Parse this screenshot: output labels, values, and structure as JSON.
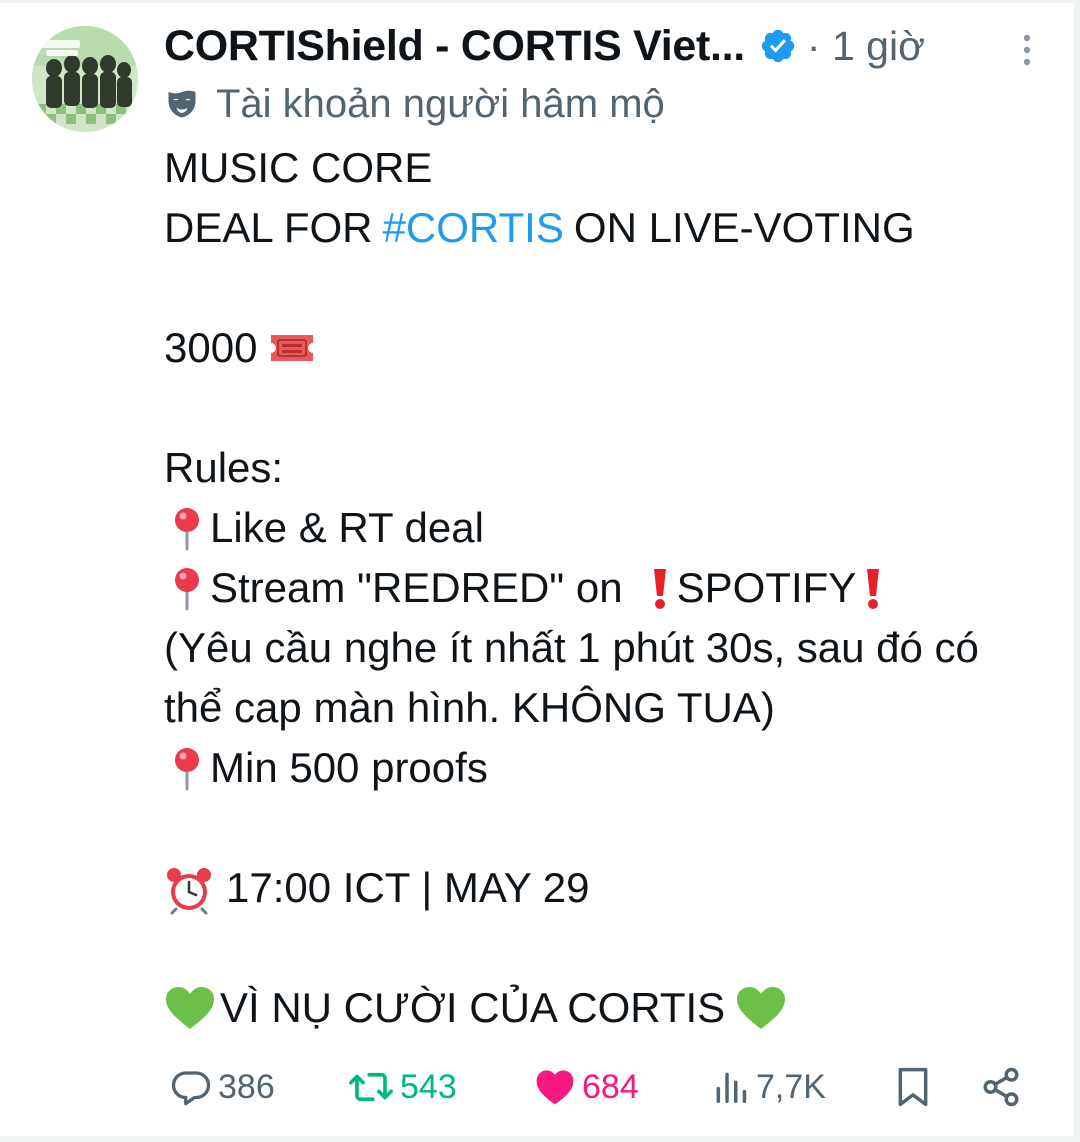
{
  "author": {
    "display_name": "CORTIShield - CORTIS Viet...",
    "verified_icon": "verified-badge-icon",
    "time": "· 1 giờ",
    "label_icon": "fan-account-mask-icon",
    "label": "Tài khoản người hâm mộ",
    "avatar": "group-photo-avatar"
  },
  "tweet": {
    "line1": "MUSIC CORE",
    "line2_pre": "DEAL FOR",
    "line2_hashtag": "#CORTIS",
    "line2_post": "ON LIVE-VOTING",
    "amount": "3000",
    "amount_icon": "ticket-icon",
    "rules_title": "Rules:",
    "rule1": "Like & RT deal",
    "rule2_pre": "Stream \"REDRED\" on",
    "rule2_platform": "SPOTIFY",
    "rule2_note_line1": "(Yêu cầu nghe ít nhất 1 phút 30s, sau đó có",
    "rule2_note_line2": "thể cap màn hình. KHÔNG TUA)",
    "rule3": "Min 500 proofs",
    "time_line": "17:00 ICT | MAY 29",
    "closing": "VÌ NỤ CƯỜI CỦA CORTIS"
  },
  "actions": {
    "replies": "386",
    "retweets": "543",
    "likes": "684",
    "views": "7,7K"
  },
  "colors": {
    "text": "#0f1419",
    "secondary": "#536471",
    "hashtag": "#1d9bf0",
    "retweet": "#00ba7c",
    "like": "#f91880",
    "verified": "#1d9bf0"
  }
}
